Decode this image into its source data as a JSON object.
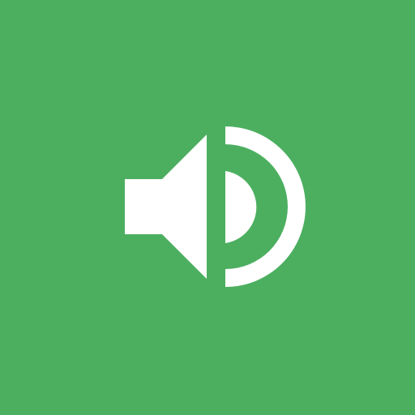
{
  "icon": {
    "name": "speaker-volume-icon",
    "background_color": "#4CAF60",
    "foreground_color": "#FFFFFF"
  }
}
